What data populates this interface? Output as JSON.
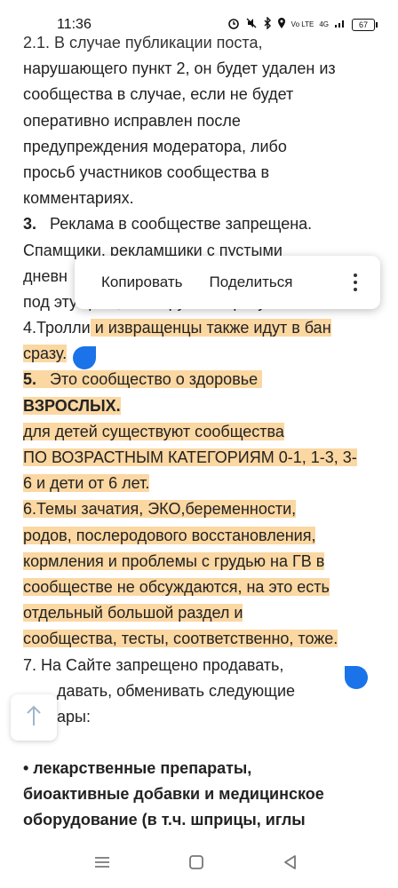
{
  "status_bar": {
    "time": "11:36",
    "lte_label": "Vo LTE",
    "network": "4G",
    "battery": "67"
  },
  "article": {
    "lines": [
      "2.1. В случае публикации поста,",
      "нарушающего пункт 2, он будет удален из",
      "сообщества в случае, если не будет",
      "оперативно исправлен после",
      "предупреждения модератора, либо",
      "просьб участников сообщества в",
      "комментариях."
    ],
    "p3_num": "3.",
    "p3_text": "Реклама в сообществе запрещена.",
    "p3_line2": "Спамщики, рекламщики с пустыми",
    "p3_line3": "дневн",
    "p3_line4": "под эту цель, блокируются сразу.",
    "p4_plain": "4.Тролли",
    "p4_hl": " и извращенцы также идут в бан",
    "p4_line2": "сразу.",
    "p5_num": "5.",
    "p5_text": "Это сообщество о здоровье",
    "p5_bold": "ВЗРОСЛЫХ.",
    "p5_lines": [
      "для детей существуют сообщества",
      "ПО ВОЗРАСТНЫМ КАТЕГОРИЯМ 0-1, 1-3, 3-",
      "6 и  дети от 6 лет."
    ],
    "p6_lines": [
      "6.Темы зачатия, ЭКО,беременности,",
      "родов, послеродового восстановления,",
      "кормления и проблемы с грудью на ГВ в",
      "сообществе не обсуждаются, на это есть",
      "отдельный большой раздел и",
      "сообщества, тесты, соответственно, тоже."
    ],
    "p7_line1": "7. На  Сайте запрещено продавать,",
    "p7_line2": "давать, обменивать следующие",
    "p7_line3": "ары:",
    "bullet_lines": [
      "• лекарственные препараты,",
      "биоактивные добавки и медицинское",
      "оборудование (в т.ч. шприцы, иглы"
    ]
  },
  "context_menu": {
    "copy": "Копировать",
    "share": "Поделиться",
    "more_icon": "more-vertical-icon"
  },
  "colors": {
    "highlight": "#fbd7a2",
    "handle": "#1a73e8"
  },
  "icons": {
    "scroll_top": "arrow-up-icon",
    "nav": [
      "menu-icon",
      "home-square-icon",
      "back-triangle-icon"
    ]
  }
}
